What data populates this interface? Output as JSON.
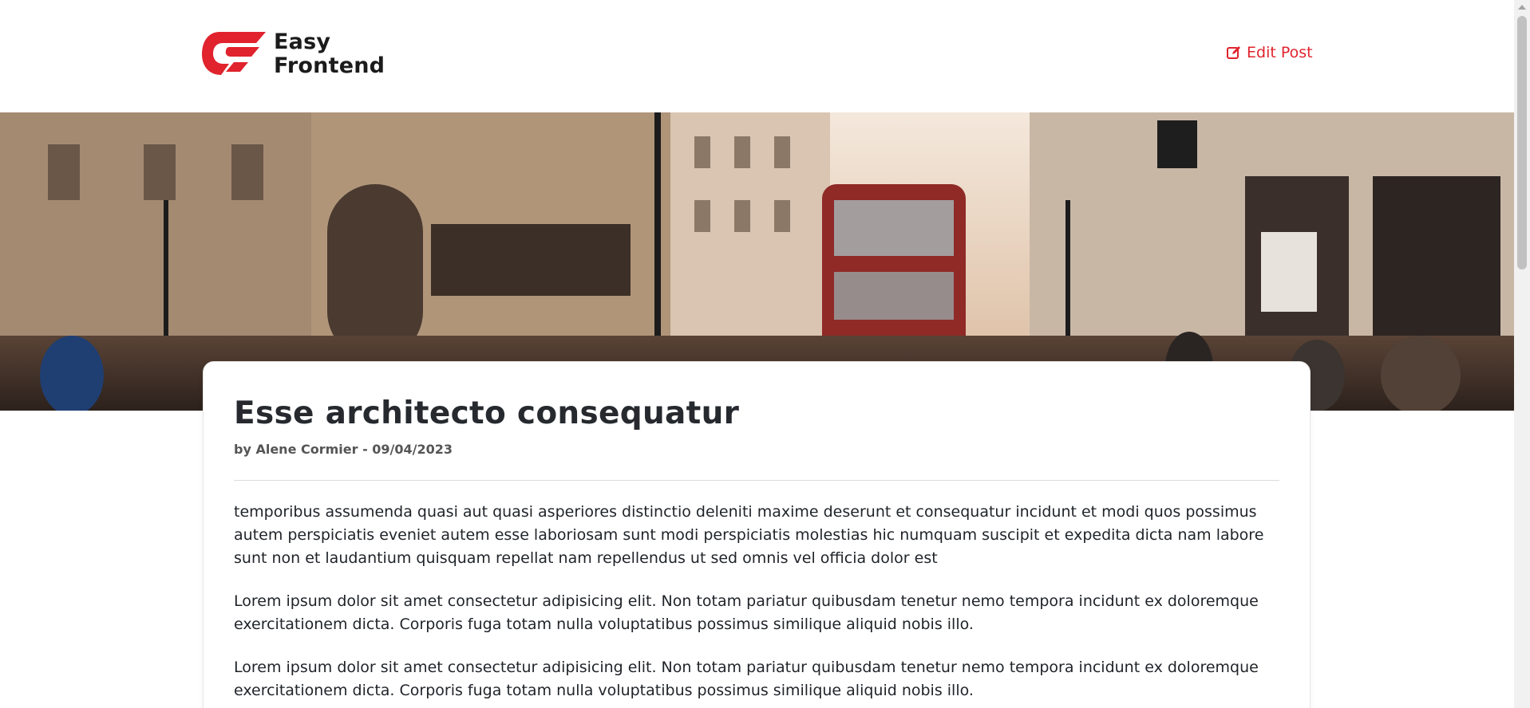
{
  "brand": {
    "line1": "Easy",
    "line2": "Frontend",
    "accent": "#e0232d"
  },
  "header": {
    "edit_label": "Edit Post",
    "edit_icon": "edit-icon"
  },
  "post": {
    "title": "Esse architecto consequatur",
    "meta": "by Alene Cormier - 09/04/2023",
    "paragraphs": [
      "temporibus assumenda quasi aut quasi asperiores distinctio deleniti maxime deserunt et consequatur incidunt et modi quos possimus autem perspiciatis eveniet autem esse laboriosam sunt modi perspiciatis molestias hic numquam suscipit et expedita dicta nam labore sunt non et laudantium quisquam repellat nam repellendus ut sed omnis vel officia dolor est",
      "Lorem ipsum dolor sit amet consectetur adipisicing elit. Non totam pariatur quibusdam tenetur nemo tempora incidunt ex doloremque exercitationem dicta. Corporis fuga totam nulla voluptatibus possimus similique aliquid nobis illo.",
      "Lorem ipsum dolor sit amet consectetur adipisicing elit. Non totam pariatur quibusdam tenetur nemo tempora incidunt ex doloremque exercitationem dicta. Corporis fuga totam nulla voluptatibus possimus similique aliquid nobis illo."
    ]
  }
}
